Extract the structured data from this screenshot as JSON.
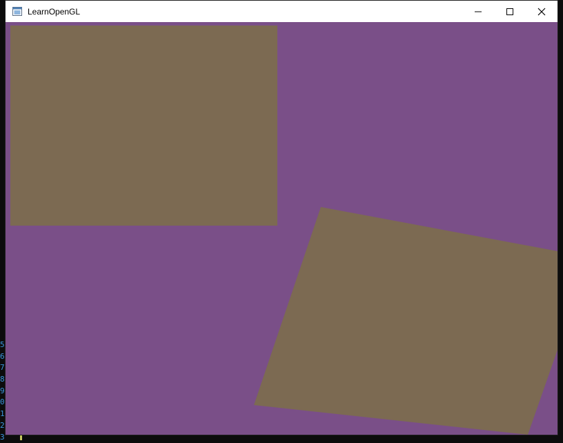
{
  "window": {
    "title": "LearnOpenGL",
    "icon": "opengl-app-icon",
    "controls": [
      "minimize-icon",
      "maximize-icon",
      "close-icon"
    ]
  },
  "viewport": {
    "clear_color": "#7a4f88",
    "quad_color": "#7c6a52",
    "quads": [
      "static-quad",
      "rotating-quad"
    ]
  },
  "terminal": {
    "line_numbers": [
      "5",
      "6",
      "7",
      "8",
      "9",
      "0",
      "1",
      "2",
      "3"
    ],
    "line_color": "#3a96dd",
    "cursor_color": "#c8c860"
  }
}
